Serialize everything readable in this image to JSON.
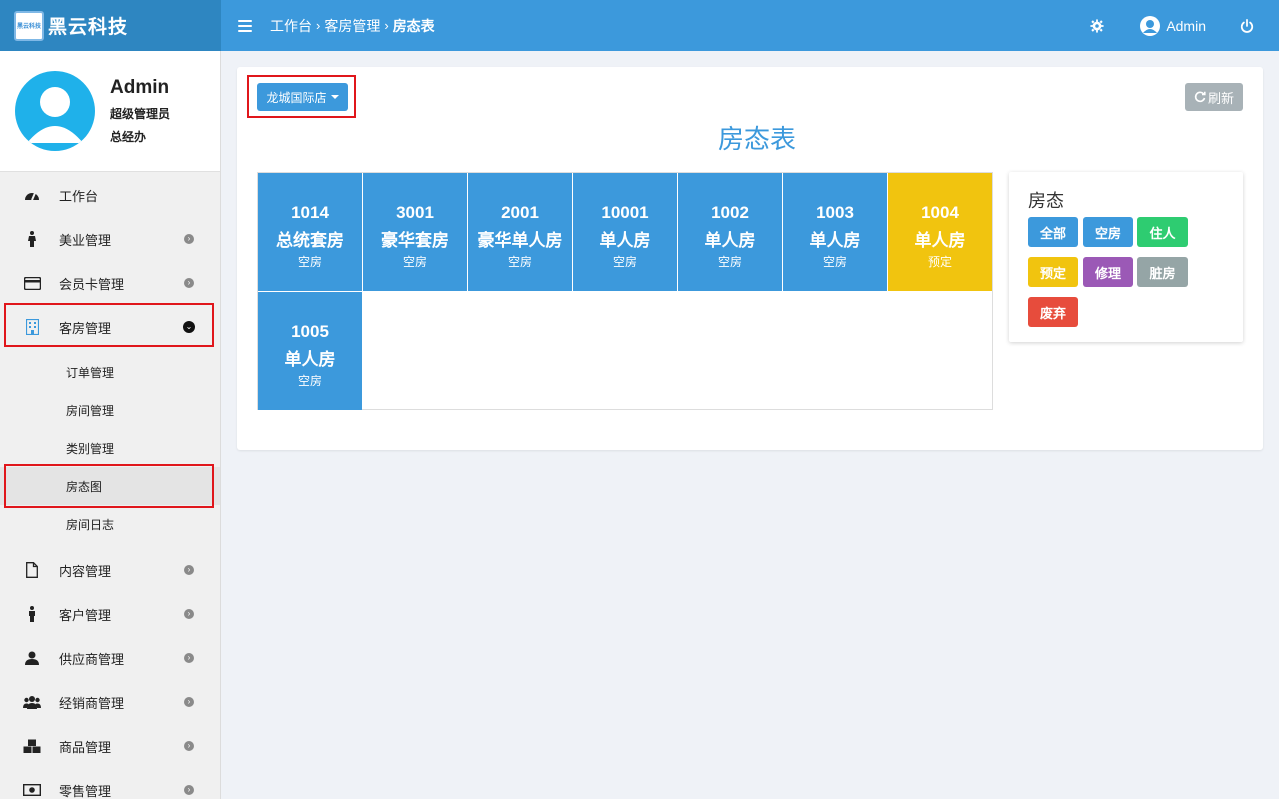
{
  "app": {
    "logo_badge": "黑云科技",
    "title": "黑云科技"
  },
  "header": {
    "breadcrumb": [
      "工作台",
      "客房管理",
      "房态表"
    ],
    "user": "Admin"
  },
  "profile": {
    "name": "Admin",
    "role": "超级管理员",
    "dept": "总经办"
  },
  "sidebar": {
    "items": [
      {
        "label": "工作台",
        "icon": "dashboard-icon"
      },
      {
        "label": "美业管理",
        "icon": "person-icon"
      },
      {
        "label": "会员卡管理",
        "icon": "credit-card-icon"
      },
      {
        "label": "客房管理",
        "icon": "building-icon"
      },
      {
        "label": "内容管理",
        "icon": "file-icon"
      },
      {
        "label": "客户管理",
        "icon": "person-icon"
      },
      {
        "label": "供应商管理",
        "icon": "user-icon"
      },
      {
        "label": "经销商管理",
        "icon": "users-icon"
      },
      {
        "label": "商品管理",
        "icon": "cubes-icon"
      },
      {
        "label": "零售管理",
        "icon": "money-icon"
      }
    ],
    "sub_items": [
      "订单管理",
      "房间管理",
      "类别管理",
      "房态图",
      "房间日志"
    ]
  },
  "main": {
    "store_button": "龙城国际店",
    "refresh_button": "刷新",
    "title": "房态表",
    "rooms": [
      {
        "no": "1014",
        "type": "总统套房",
        "state": "空房"
      },
      {
        "no": "3001",
        "type": "豪华套房",
        "state": "空房"
      },
      {
        "no": "2001",
        "type": "豪华单人房",
        "state": "空房"
      },
      {
        "no": "10001",
        "type": "单人房",
        "state": "空房"
      },
      {
        "no": "1002",
        "type": "单人房",
        "state": "空房"
      },
      {
        "no": "1003",
        "type": "单人房",
        "state": "空房"
      },
      {
        "no": "1004",
        "type": "单人房",
        "state": "预定"
      },
      {
        "no": "1005",
        "type": "单人房",
        "state": "空房"
      }
    ],
    "legend": {
      "title": "房态",
      "tags": [
        {
          "label": "全部",
          "color": "#3c99dc"
        },
        {
          "label": "空房",
          "color": "#3c99dc"
        },
        {
          "label": "住人",
          "color": "#2ecc71"
        },
        {
          "label": "预定",
          "color": "#f1c40f"
        },
        {
          "label": "修理",
          "color": "#9b59b6"
        },
        {
          "label": "脏房",
          "color": "#95a5a6"
        },
        {
          "label": "废弃",
          "color": "#e74c3c"
        }
      ]
    }
  },
  "colors": {
    "primary": "#3c99dc",
    "reserved": "#f1c40f",
    "highlight": "#e0161b"
  }
}
